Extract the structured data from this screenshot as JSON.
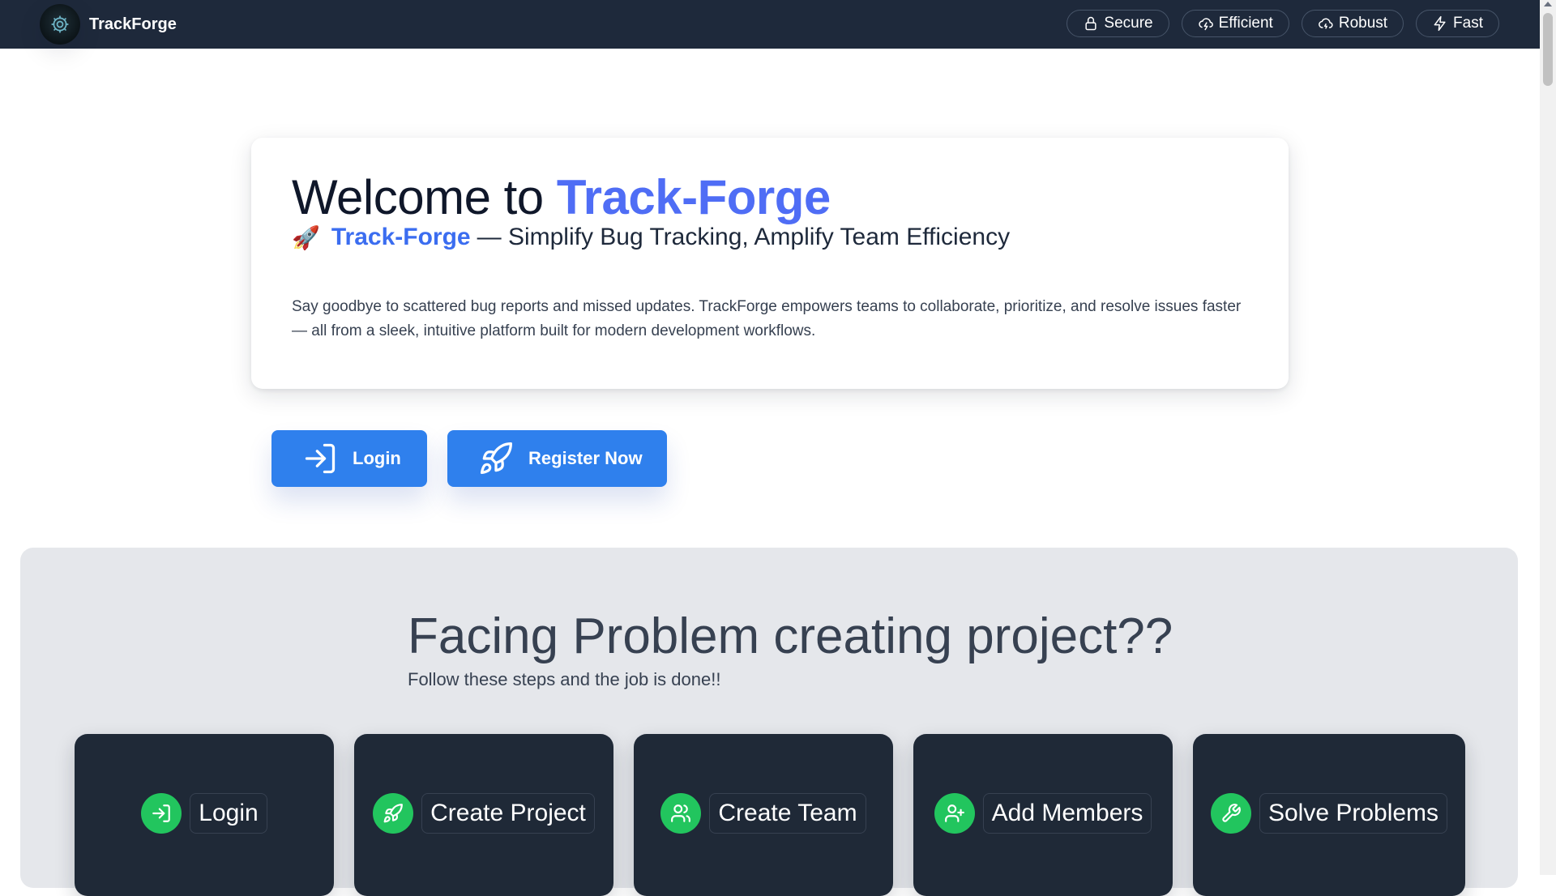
{
  "navbar": {
    "brand": "TrackForge",
    "pills": [
      {
        "label": "Secure",
        "icon": "lock-icon"
      },
      {
        "label": "Efficient",
        "icon": "cloud-lightning-icon"
      },
      {
        "label": "Robust",
        "icon": "cloud-icon"
      },
      {
        "label": "Fast",
        "icon": "zap-icon"
      }
    ]
  },
  "hero": {
    "title_prefix": "Welcome to ",
    "title_accent": "Track-Forge",
    "subtitle_emoji": "🚀",
    "subtitle_accent": "Track-Forge",
    "subtitle_rest": "— Simplify Bug Tracking, Amplify Team Efficiency",
    "description": "Say goodbye to scattered bug reports and missed updates. TrackForge empowers teams to collaborate, prioritize, and resolve issues faster — all from a sleek, intuitive platform built for modern development workflows."
  },
  "cta": {
    "login_label": "Login",
    "register_label": "Register Now"
  },
  "steps": {
    "title": "Facing Problem creating project??",
    "subtitle": "Follow these steps and the job is done!!",
    "items": [
      {
        "label": "Login",
        "icon": "log-in-icon"
      },
      {
        "label": "Create Project",
        "icon": "rocket-icon"
      },
      {
        "label": "Create Team",
        "icon": "users-icon"
      },
      {
        "label": "Add Members",
        "icon": "user-plus-icon"
      },
      {
        "label": "Solve Problems",
        "icon": "wrench-icon"
      }
    ]
  },
  "colors": {
    "navbar_bg": "#1e293b",
    "accent_blue": "#4f6df5",
    "button_blue": "#2f80ed",
    "step_green": "#22c55e",
    "card_dark": "#1f2937",
    "section_bg": "#e5e7eb"
  }
}
